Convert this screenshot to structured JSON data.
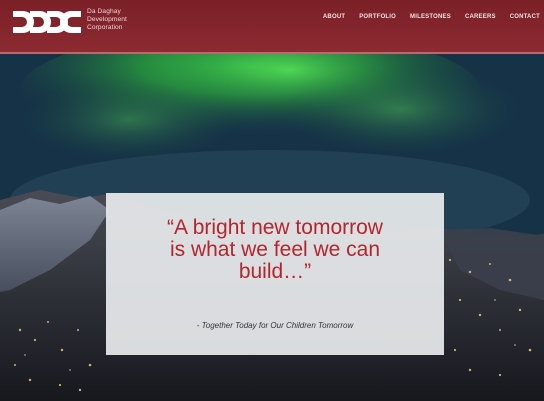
{
  "header": {
    "logo_mark": "DDDC",
    "logo_lines": [
      "Da Daghay",
      "Development",
      "Corporation"
    ],
    "nav": [
      "ABOUT",
      "PORTFOLIO",
      "MILESTONES",
      "CAREERS",
      "CONTACT"
    ],
    "brand_color": "#8a2830"
  },
  "hero": {
    "quote_lines": [
      "“A bright new tomorrow",
      "is what we feel we can",
      "build…”"
    ],
    "attribution": "- Together Today for Our Children Tomorrow",
    "quote_color": "#b3262d"
  }
}
